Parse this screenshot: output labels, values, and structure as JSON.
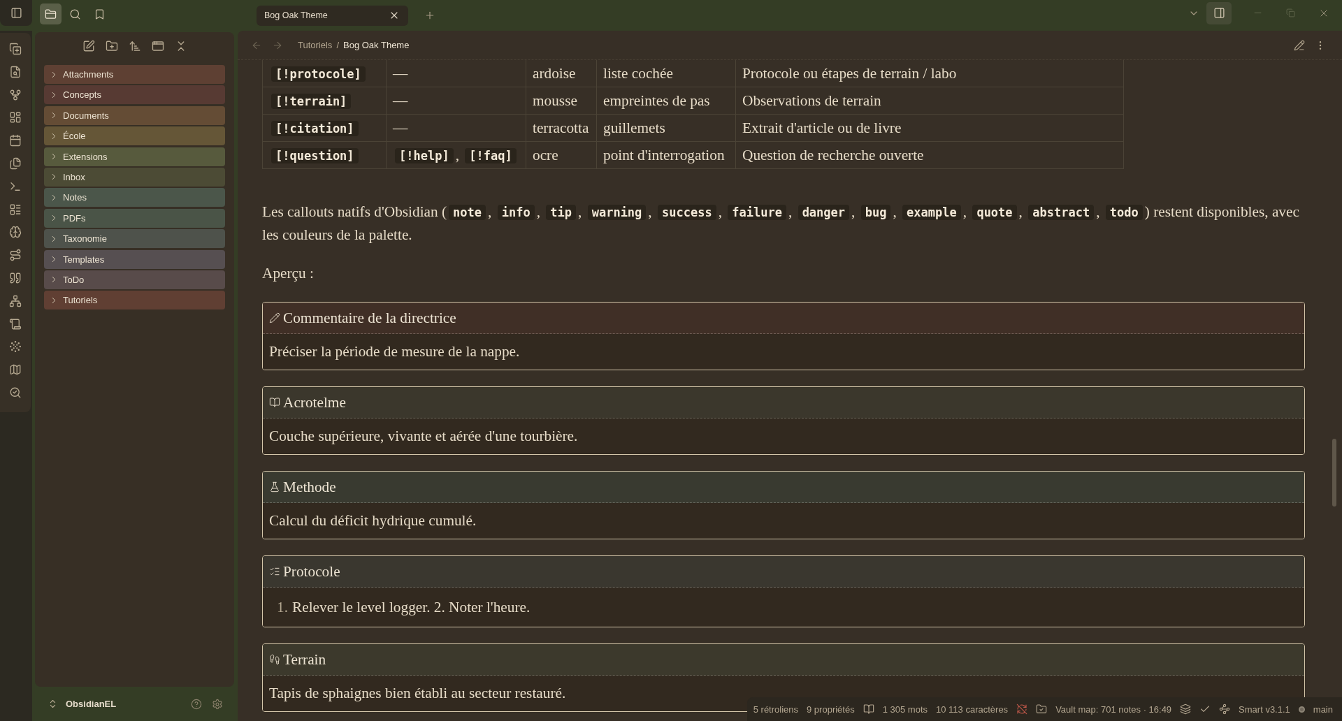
{
  "top_bar": {
    "sidebar_tabs": [
      {
        "kind": "files",
        "selected": true
      },
      {
        "kind": "search",
        "selected": false
      },
      {
        "kind": "bookmarks",
        "selected": false
      }
    ],
    "tabs": [
      {
        "title": "Bog Oak Theme",
        "selected": true
      }
    ]
  },
  "file_explorer": {
    "folders": [
      {
        "name": "Attachments",
        "color": "#5e4033",
        "expanded": false
      },
      {
        "name": "Concepts",
        "color": "#573a33",
        "expanded": false
      },
      {
        "name": "Documents",
        "color": "#644c35",
        "expanded": false
      },
      {
        "name": "École",
        "color": "#655637",
        "expanded": false
      },
      {
        "name": "Extensions",
        "color": "#575a3d",
        "expanded": false
      },
      {
        "name": "Inbox",
        "color": "#4c4b35",
        "expanded": false
      },
      {
        "name": "Notes",
        "color": "#4b564a",
        "expanded": false
      },
      {
        "name": "PDFs",
        "color": "#4a5447",
        "expanded": false
      },
      {
        "name": "Taxonomie",
        "color": "#4e524b",
        "expanded": false
      },
      {
        "name": "Templates",
        "color": "#564f51",
        "expanded": false
      },
      {
        "name": "ToDo",
        "color": "#584b4a",
        "expanded": false
      },
      {
        "name": "Tutoriels",
        "color": "#603f33",
        "expanded": false
      }
    ]
  },
  "vault": {
    "name": "ObsidianEL"
  },
  "breadcrumb": {
    "items": [
      "Tutoriels",
      "Bog Oak Theme"
    ],
    "separator": "/"
  },
  "document": {
    "table": {
      "rows": [
        {
          "cells": [
            [
              {
                "kind": "code",
                "text": "[!protocole]"
              }
            ],
            "—",
            "ardoise",
            "liste cochée",
            "Protocole ou étapes de terrain / labo"
          ]
        },
        {
          "cells": [
            [
              {
                "kind": "code",
                "text": "[!terrain]"
              }
            ],
            "—",
            "mousse",
            "empreintes de pas",
            "Observations de terrain"
          ]
        },
        {
          "cells": [
            [
              {
                "kind": "code",
                "text": "[!citation]"
              }
            ],
            "—",
            "terracotta",
            "guillemets",
            "Extrait d'article ou de livre"
          ]
        },
        {
          "cells": [
            [
              {
                "kind": "code",
                "text": "[!question]"
              }
            ],
            [
              {
                "kind": "code",
                "text": "[!help]"
              },
              {
                "kind": "text",
                "text": ", "
              },
              {
                "kind": "code",
                "text": "[!faq]"
              }
            ],
            "ocre",
            "point d'interrogation",
            "Question de recherche ouverte"
          ]
        }
      ]
    },
    "paragraphs": [
      [
        {
          "kind": "text",
          "text": "Les callouts natifs d'Obsidian ("
        },
        {
          "kind": "code",
          "text": "note"
        },
        {
          "kind": "text",
          "text": ", "
        },
        {
          "kind": "code",
          "text": "info"
        },
        {
          "kind": "text",
          "text": ", "
        },
        {
          "kind": "code",
          "text": "tip"
        },
        {
          "kind": "text",
          "text": ", "
        },
        {
          "kind": "code",
          "text": "warning"
        },
        {
          "kind": "text",
          "text": ", "
        },
        {
          "kind": "code",
          "text": "success"
        },
        {
          "kind": "text",
          "text": ", "
        },
        {
          "kind": "code",
          "text": "failure"
        },
        {
          "kind": "text",
          "text": ", "
        },
        {
          "kind": "code",
          "text": "danger"
        },
        {
          "kind": "text",
          "text": ", "
        },
        {
          "kind": "code",
          "text": "bug"
        },
        {
          "kind": "text",
          "text": ", "
        },
        {
          "kind": "code",
          "text": "example"
        },
        {
          "kind": "text",
          "text": ", "
        },
        {
          "kind": "code",
          "text": "quote"
        },
        {
          "kind": "text",
          "text": ", "
        },
        {
          "kind": "code",
          "text": "abstract"
        },
        {
          "kind": "text",
          "text": ", "
        },
        {
          "kind": "code",
          "text": "todo"
        },
        {
          "kind": "text",
          "text": ") restent disponibles, avec les couleurs de la palette."
        }
      ],
      [
        {
          "kind": "text",
          "text": "Aperçu :"
        }
      ]
    ],
    "callouts": [
      {
        "kind": "comment",
        "color": "#402f26",
        "title": "Commentaire de la directrice",
        "body": "Préciser la période de mesure de la nappe."
      },
      {
        "kind": "definition",
        "color": "#3b372c",
        "title": "Acrotelme",
        "body": "Couche supérieure, vivante et aérée d'une tourbière."
      },
      {
        "kind": "method",
        "color": "#393a30",
        "title": "Methode",
        "body": "Calcul du déficit hydrique cumulé."
      },
      {
        "kind": "protocol",
        "color": "#3a372f",
        "title": "Protocole",
        "list": [
          {
            "marker": "1.",
            "text": "Relever le level logger. 2. Noter l'heure."
          }
        ]
      },
      {
        "kind": "field",
        "color": "#3c392c",
        "title": "Terrain",
        "body": "Tapis de sphaignes bien établi au secteur restauré."
      }
    ]
  },
  "status_bar": {
    "backlinks": "5 rétroliens",
    "properties": "9 propriétés",
    "words": "1 305 mots",
    "characters": "10 113 caractères",
    "sync": {
      "on": false
    },
    "vault_map": "Vault map: 701 notes · 16:49",
    "plugin": "Smart v3.1.1",
    "branch": "main"
  }
}
